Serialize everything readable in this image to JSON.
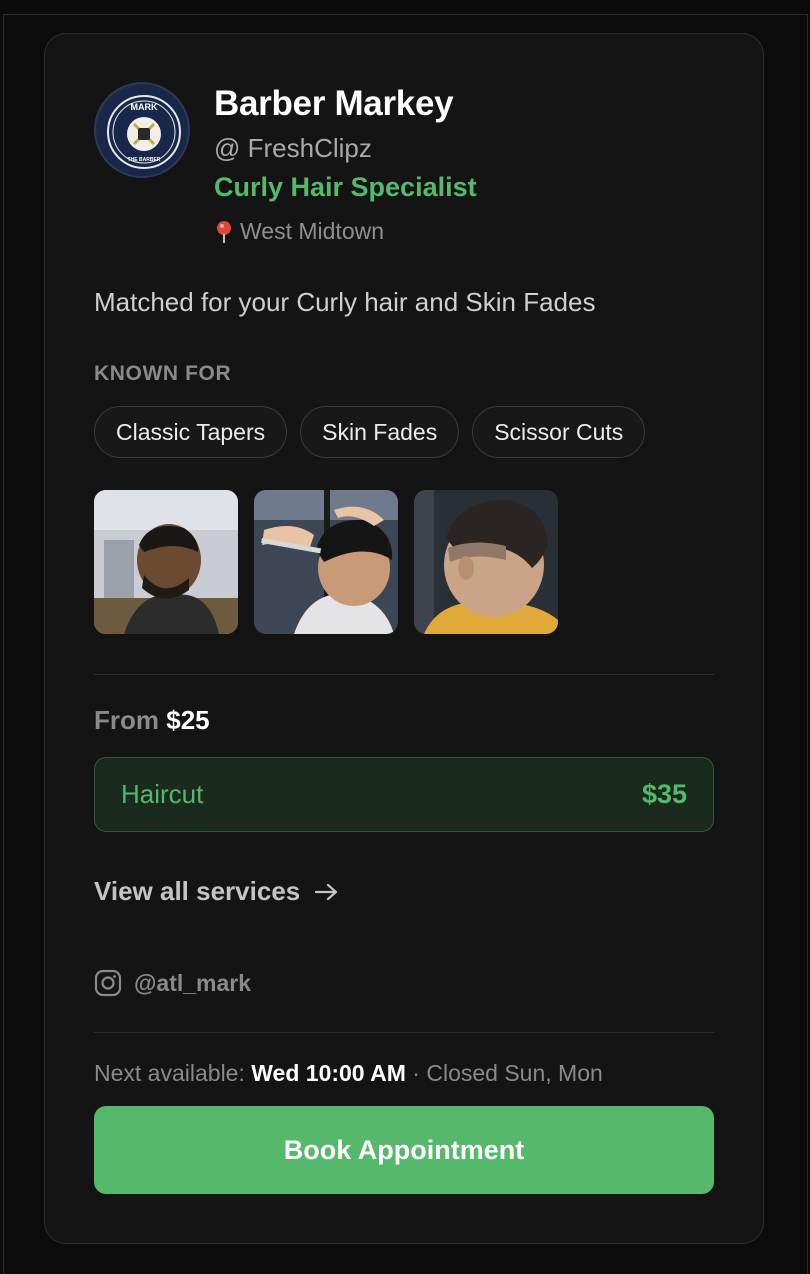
{
  "barber": {
    "name": "Barber Markey",
    "handle": "@ FreshClipz",
    "specialty": "Curly Hair Specialist",
    "location": "West Midtown",
    "avatar_text_top": "MARK",
    "avatar_text_bottom": "THE BARBER"
  },
  "match_text": "Matched for your Curly hair and Skin Fades",
  "known_for": {
    "heading": "KNOWN FOR",
    "tags": [
      "Classic Tapers",
      "Skin Fades",
      "Scissor Cuts"
    ]
  },
  "photos": [
    "haircut-photo-1",
    "haircut-photo-2",
    "haircut-photo-3"
  ],
  "pricing": {
    "from_label": "From",
    "from_price": "$25",
    "service_name": "Haircut",
    "service_price": "$35"
  },
  "view_all": "View all services",
  "instagram": "@atl_mark",
  "availability": {
    "label": "Next available:",
    "time": "Wed 10:00 AM",
    "closed": "· Closed Sun, Mon"
  },
  "book_button": "Book Appointment",
  "colors": {
    "accent": "#55b86a",
    "background": "#141414",
    "text": "#ffffff"
  }
}
